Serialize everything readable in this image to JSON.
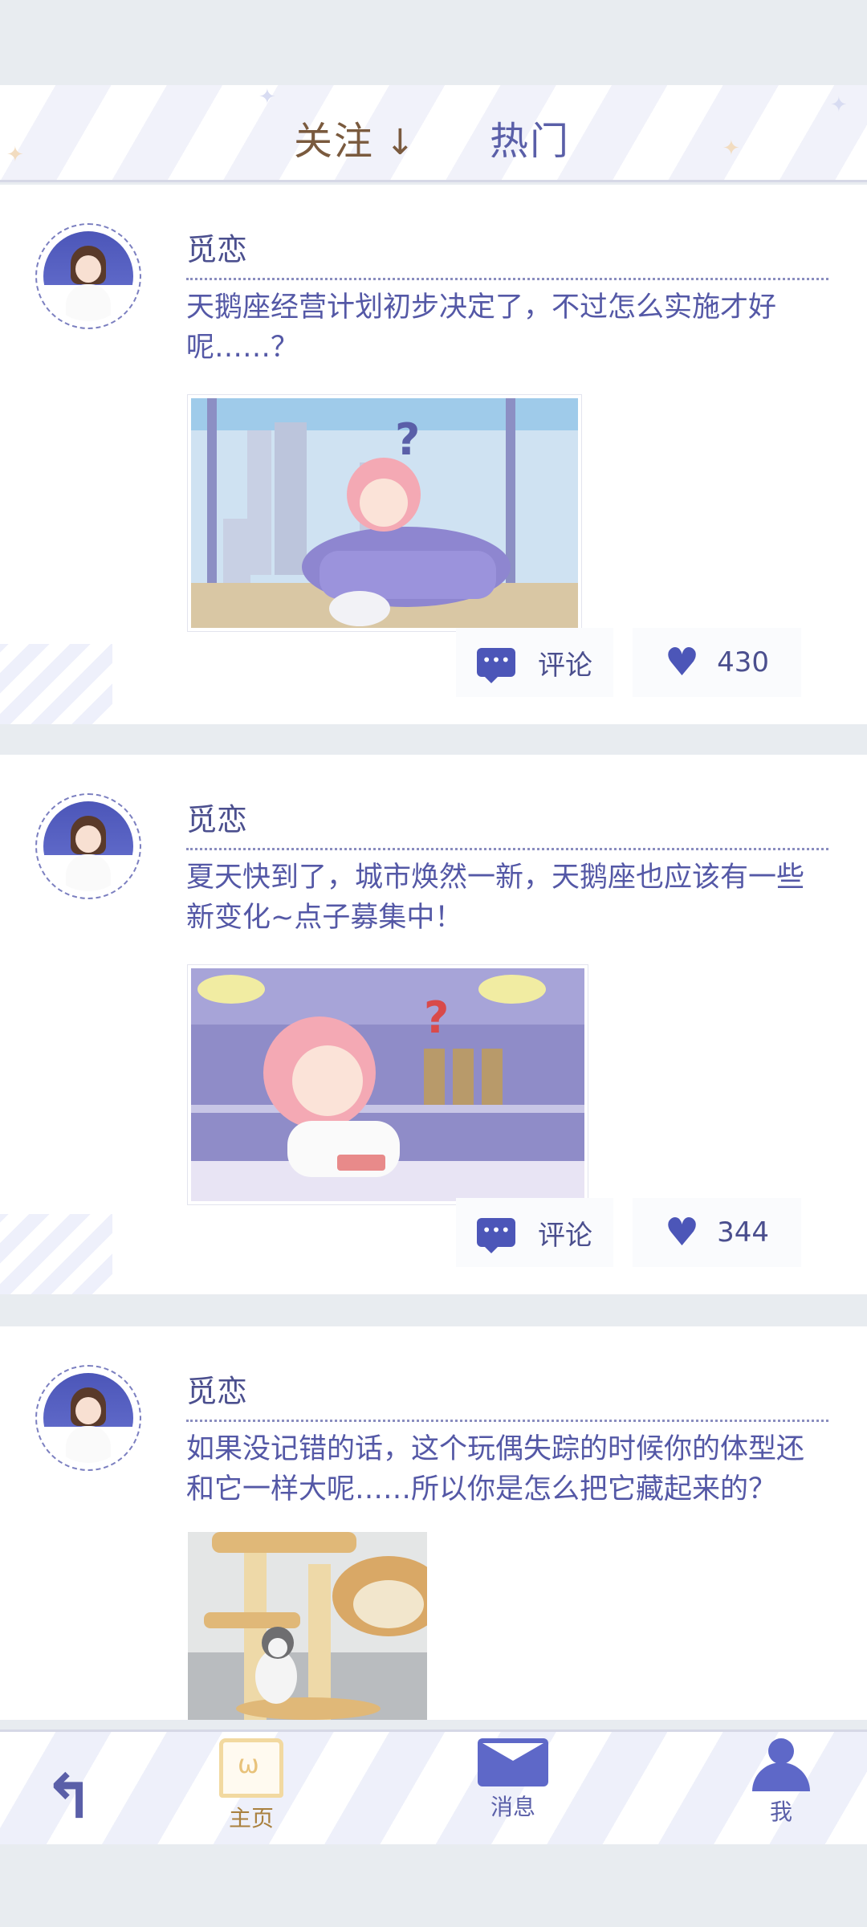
{
  "tabs": {
    "follow": "关注",
    "follow_arrow": "↓",
    "hot": "热门"
  },
  "posts": [
    {
      "author": "觅恋",
      "text": "天鹅座经营计划初步决定了，不过怎么实施才好呢……？",
      "comment_label": "评论",
      "likes": "430"
    },
    {
      "author": "觅恋",
      "text": "夏天快到了，城市焕然一新，天鹅座也应该有一些新变化~点子募集中！",
      "comment_label": "评论",
      "likes": "344"
    },
    {
      "author": "觅恋",
      "text": "如果没记错的话，这个玩偶失踪的时候你的体型还和它一样大呢……所以你是怎么把它藏起来的？"
    }
  ],
  "nav": {
    "home": "主页",
    "messages": "消息",
    "me": "我"
  },
  "colors": {
    "accent": "#4c56b8",
    "text_purple": "#5458a6",
    "tab_brown": "#7a5a3e",
    "home_gold": "#a9803e"
  }
}
